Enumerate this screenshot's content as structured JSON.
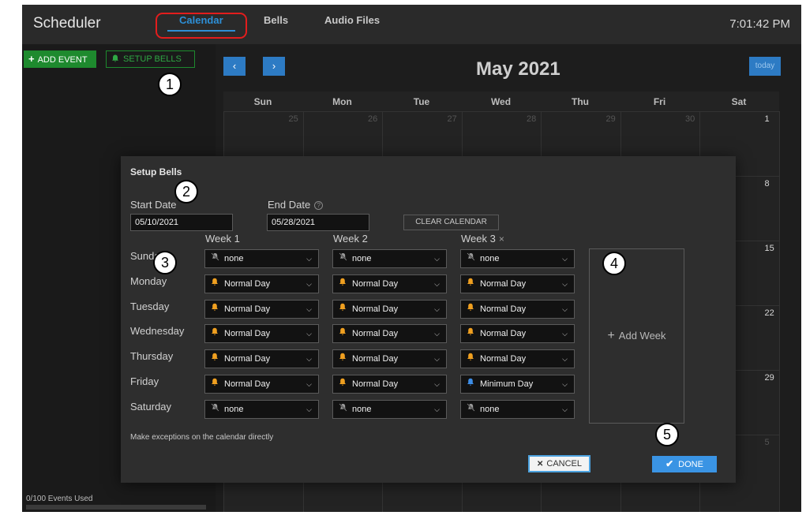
{
  "topbar": {
    "app_title": "Scheduler",
    "tabs": [
      "Calendar",
      "Bells",
      "Audio Files"
    ],
    "clock": "7:01:42 PM"
  },
  "sidebar": {
    "add_event": "ADD EVENT",
    "setup_bells": "SETUP BELLS",
    "events_used": "0/100 Events Used"
  },
  "calendar": {
    "prev": "‹",
    "next": "›",
    "title": "May 2021",
    "today": "today",
    "days_of_week": [
      "Sun",
      "Mon",
      "Tue",
      "Wed",
      "Thu",
      "Fri",
      "Sat"
    ],
    "first_row": [
      "25",
      "26",
      "27",
      "28",
      "29",
      "30",
      "1"
    ],
    "saturday_dates": [
      "8",
      "15",
      "22",
      "29",
      "5"
    ]
  },
  "setup_bells": {
    "title": "Setup Bells",
    "start_date_label": "Start Date",
    "start_date": "05/10/2021",
    "end_date_label": "End Date",
    "end_date": "05/28/2021",
    "clear_calendar": "CLEAR CALENDAR",
    "weeks": [
      "Week 1",
      "Week 2",
      "Week 3"
    ],
    "remove_week": "×",
    "days": [
      "Sunday",
      "Monday",
      "Tuesday",
      "Wednesday",
      "Thursday",
      "Friday",
      "Saturday"
    ],
    "schedule": [
      [
        "none",
        "none",
        "none"
      ],
      [
        "Normal Day",
        "Normal Day",
        "Normal Day"
      ],
      [
        "Normal Day",
        "Normal Day",
        "Normal Day"
      ],
      [
        "Normal Day",
        "Normal Day",
        "Normal Day"
      ],
      [
        "Normal Day",
        "Normal Day",
        "Normal Day"
      ],
      [
        "Normal Day",
        "Normal Day",
        "Minimum Day"
      ],
      [
        "none",
        "none",
        "none"
      ]
    ],
    "add_week": "Add Week",
    "exceptions_note": "Make exceptions on the calendar directly",
    "cancel": "CANCEL",
    "done": "DONE"
  },
  "callouts": [
    "1",
    "2",
    "3",
    "4",
    "5"
  ],
  "colors": {
    "accent_blue": "#2d8fd6",
    "green": "#1e8a2e",
    "bell_orange": "#f0a020",
    "bell_blue": "#3d8ee8",
    "highlight_red": "#e21d1d"
  },
  "icons": {
    "bell": "bell-icon",
    "muted": "bell-off-icon",
    "chevron": "chevron-down-icon"
  }
}
